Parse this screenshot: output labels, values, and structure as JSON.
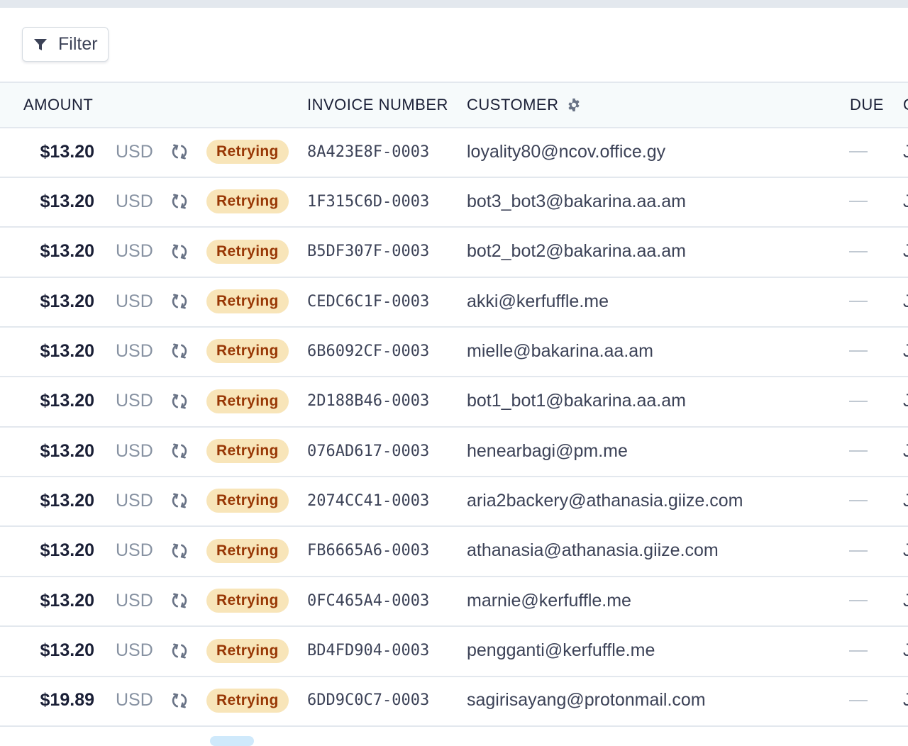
{
  "toolbar": {
    "filter_label": "Filter"
  },
  "headers": {
    "amount": "AMOUNT",
    "invoice_number": "INVOICE NUMBER",
    "customer": "CUSTOMER",
    "due": "DUE",
    "next": "C"
  },
  "colors": {
    "badge_bg": "#f8e5b9",
    "badge_text": "#983705",
    "border": "#e3e8ee",
    "header_bg": "#f6fafb"
  },
  "icons": {
    "filter": "filter-funnel-icon",
    "gear": "gear-icon",
    "retry": "retry-icon"
  },
  "rows": [
    {
      "amount": "$13.20",
      "currency": "USD",
      "status": "Retrying",
      "invoice": "8A423E8F-0003",
      "customer": "loyality80@ncov.office.gy",
      "due": "—",
      "next": "J"
    },
    {
      "amount": "$13.20",
      "currency": "USD",
      "status": "Retrying",
      "invoice": "1F315C6D-0003",
      "customer": "bot3_bot3@bakarina.aa.am",
      "due": "—",
      "next": "J"
    },
    {
      "amount": "$13.20",
      "currency": "USD",
      "status": "Retrying",
      "invoice": "B5DF307F-0003",
      "customer": "bot2_bot2@bakarina.aa.am",
      "due": "—",
      "next": "J"
    },
    {
      "amount": "$13.20",
      "currency": "USD",
      "status": "Retrying",
      "invoice": "CEDC6C1F-0003",
      "customer": "akki@kerfuffle.me",
      "due": "—",
      "next": "J"
    },
    {
      "amount": "$13.20",
      "currency": "USD",
      "status": "Retrying",
      "invoice": "6B6092CF-0003",
      "customer": "mielle@bakarina.aa.am",
      "due": "—",
      "next": "J"
    },
    {
      "amount": "$13.20",
      "currency": "USD",
      "status": "Retrying",
      "invoice": "2D188B46-0003",
      "customer": "bot1_bot1@bakarina.aa.am",
      "due": "—",
      "next": "J"
    },
    {
      "amount": "$13.20",
      "currency": "USD",
      "status": "Retrying",
      "invoice": "076AD617-0003",
      "customer": "henearbagi@pm.me",
      "due": "—",
      "next": "J"
    },
    {
      "amount": "$13.20",
      "currency": "USD",
      "status": "Retrying",
      "invoice": "2074CC41-0003",
      "customer": "aria2backery@athanasia.giize.com",
      "due": "—",
      "next": "J"
    },
    {
      "amount": "$13.20",
      "currency": "USD",
      "status": "Retrying",
      "invoice": "FB6665A6-0003",
      "customer": "athanasia@athanasia.giize.com",
      "due": "—",
      "next": "J"
    },
    {
      "amount": "$13.20",
      "currency": "USD",
      "status": "Retrying",
      "invoice": "0FC465A4-0003",
      "customer": "marnie@kerfuffle.me",
      "due": "—",
      "next": "J"
    },
    {
      "amount": "$13.20",
      "currency": "USD",
      "status": "Retrying",
      "invoice": "BD4FD904-0003",
      "customer": "pengganti@kerfuffle.me",
      "due": "—",
      "next": "J"
    },
    {
      "amount": "$19.89",
      "currency": "USD",
      "status": "Retrying",
      "invoice": "6DD9C0C7-0003",
      "customer": "sagirisayang@protonmail.com",
      "due": "—",
      "next": "J"
    }
  ]
}
